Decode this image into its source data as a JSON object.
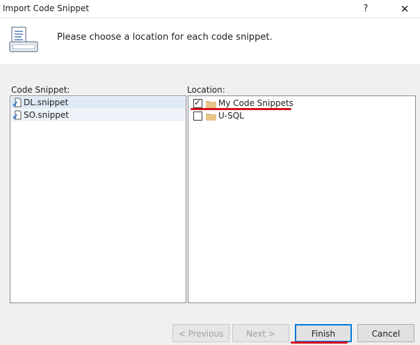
{
  "window": {
    "title": "Import Code Snippet",
    "help_glyph": "?",
    "close_glyph": "✕"
  },
  "header": {
    "icon": "snippet-import-icon",
    "instruction": "Please choose a location for each code snippet."
  },
  "snippets": {
    "label": "Code Snippet:",
    "items": [
      {
        "label": "DL.snippet",
        "icon": "snippet-file-icon",
        "selected": true
      },
      {
        "label": "SO.snippet",
        "icon": "snippet-file-icon",
        "selected": false
      }
    ]
  },
  "locations": {
    "label": "Location:",
    "items": [
      {
        "label": "My Code Snippets",
        "checked": true,
        "icon": "folder-icon"
      },
      {
        "label": "U-SQL",
        "checked": false,
        "icon": "folder-icon"
      }
    ]
  },
  "buttons": {
    "previous": "< Previous",
    "next": "Next >",
    "finish": "Finish",
    "cancel": "Cancel"
  },
  "colors": {
    "annotation": "#d5101f",
    "selection": "#dfeaf6",
    "folder": "#dcb67a",
    "focus_border": "#0078d7"
  }
}
